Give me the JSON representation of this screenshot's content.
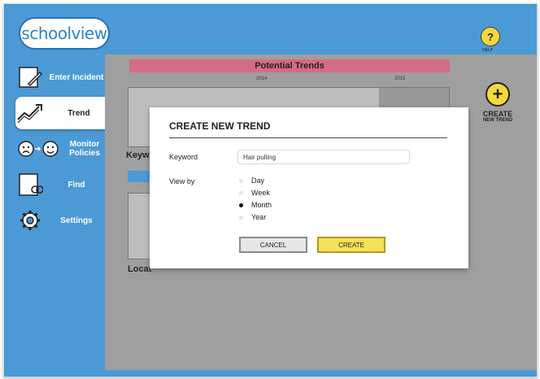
{
  "app": {
    "logo_text": "schoolview",
    "help_label": "HELP"
  },
  "sidebar": {
    "items": [
      {
        "label": "Enter Incident",
        "icon": "pencil-note-icon",
        "active": false
      },
      {
        "label": "Trend",
        "icon": "trend-chart-icon",
        "active": true
      },
      {
        "label": "Monitor Policies",
        "icon": "faces-icon",
        "active": false
      },
      {
        "label": "Find",
        "icon": "search-doc-icon",
        "active": false
      },
      {
        "label": "Settings",
        "icon": "gear-icon",
        "active": false
      }
    ]
  },
  "background": {
    "title": "Potential Trends",
    "year_labels": [
      "2014",
      "2015"
    ],
    "keyword_label": "Keyw",
    "location_label": "Locat"
  },
  "create_new_trend": {
    "label": "CREATE",
    "sublabel": "NEW TREND"
  },
  "modal": {
    "title": "CREATE NEW TREND",
    "keyword_label": "Keyword",
    "keyword_value": "Hair pulling",
    "viewby_label": "View by",
    "options": [
      {
        "label": "Day",
        "checked": false
      },
      {
        "label": "Week",
        "checked": false
      },
      {
        "label": "Month",
        "checked": true
      },
      {
        "label": "Year",
        "checked": false
      }
    ],
    "cancel_label": "CANCEL",
    "create_label": "CREATE"
  },
  "colors": {
    "accent": "#4b9ad6",
    "title_bar": "#d66b86",
    "create_button": "#f5e05a",
    "help_button": "#f5d83b"
  }
}
